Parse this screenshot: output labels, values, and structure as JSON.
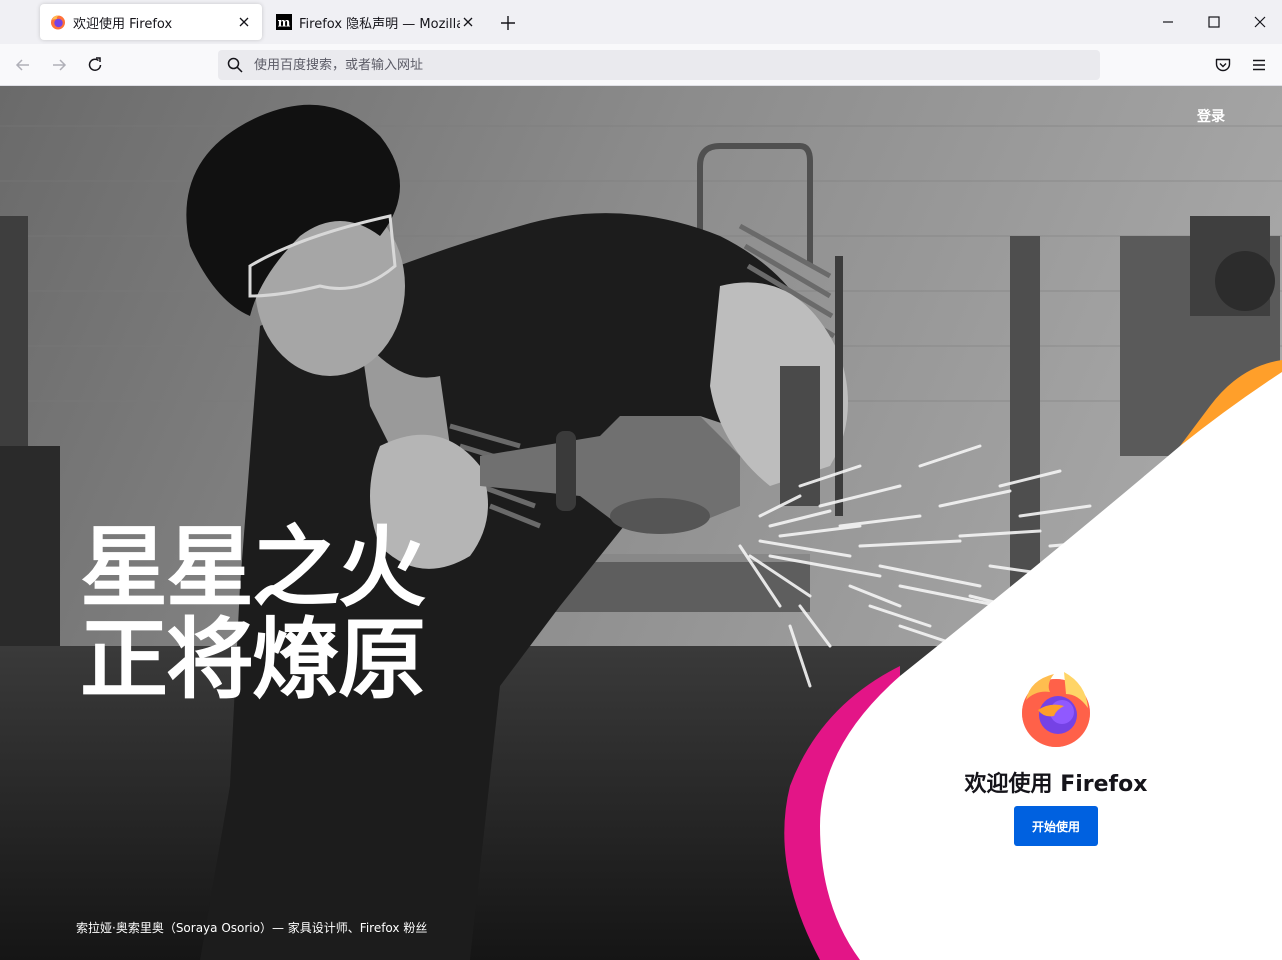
{
  "tabs": [
    {
      "title": "欢迎使用 Firefox",
      "active": true
    },
    {
      "title": "Firefox 隐私声明 — Mozilla",
      "active": false
    }
  ],
  "toolbar": {
    "url_placeholder": "使用百度搜索，或者输入网址"
  },
  "page": {
    "signin": "登录",
    "headline_line1": "星星之火",
    "headline_line2": "正将燎原",
    "caption": "索拉娅·奥索里奥（Soraya Osorio）— 家具设计师、Firefox 粉丝",
    "welcome_title": "欢迎使用 Firefox",
    "start_button": "开始使用"
  },
  "colors": {
    "accent_button": "#0061e0",
    "shape_orange": "#ff9f2a",
    "shape_magenta": "#e31587"
  },
  "icons": [
    "firefox-logo-icon",
    "mozilla-m-icon",
    "close-icon",
    "plus-icon",
    "minimize-icon",
    "maximize-icon",
    "back-arrow-icon",
    "forward-arrow-icon",
    "reload-icon",
    "search-icon",
    "pocket-icon",
    "hamburger-menu-icon"
  ]
}
